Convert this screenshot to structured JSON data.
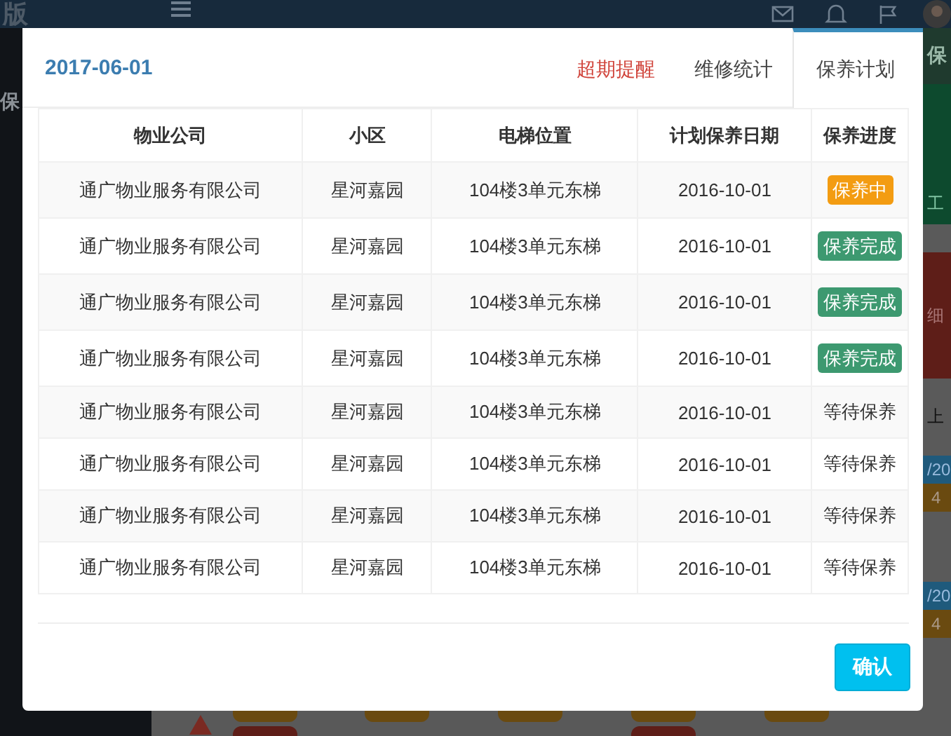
{
  "background": {
    "app_title": "版",
    "sidebar_text": "保",
    "right_strip": [
      {
        "kind": "dark",
        "text": "保"
      },
      {
        "kind": "green"
      },
      {
        "kind": "green",
        "text": "工"
      },
      {
        "kind": "gray"
      },
      {
        "kind": "red",
        "text": "细"
      },
      {
        "kind": "gray",
        "text": "上"
      },
      {
        "kind": "blue",
        "text": "/20"
      },
      {
        "kind": "brown",
        "text": "4"
      },
      {
        "kind": "gray"
      },
      {
        "kind": "blue",
        "text": "/20"
      },
      {
        "kind": "brown",
        "text": "4"
      }
    ]
  },
  "dialog": {
    "title": "2017-06-01",
    "tabs": [
      {
        "label": "超期提醒",
        "kind": "alert",
        "selected": false
      },
      {
        "label": "维修统计",
        "kind": "normal",
        "selected": false
      },
      {
        "label": "保养计划",
        "kind": "normal",
        "selected": true
      }
    ],
    "table": {
      "columns": [
        "物业公司",
        "小区",
        "电梯位置",
        "计划保养日期",
        "保养进度"
      ],
      "rows": [
        {
          "company": "通广物业服务有限公司",
          "community": "星河嘉园",
          "location": "104楼3单元东梯",
          "date": "2016-10-01",
          "status": {
            "kind": "in_progress",
            "text": "保养中"
          }
        },
        {
          "company": "通广物业服务有限公司",
          "community": "星河嘉园",
          "location": "104楼3单元东梯",
          "date": "2016-10-01",
          "status": {
            "kind": "done",
            "text": "保养完成"
          }
        },
        {
          "company": "通广物业服务有限公司",
          "community": "星河嘉园",
          "location": "104楼3单元东梯",
          "date": "2016-10-01",
          "status": {
            "kind": "done",
            "text": "保养完成"
          }
        },
        {
          "company": "通广物业服务有限公司",
          "community": "星河嘉园",
          "location": "104楼3单元东梯",
          "date": "2016-10-01",
          "status": {
            "kind": "done",
            "text": "保养完成"
          }
        },
        {
          "company": "通广物业服务有限公司",
          "community": "星河嘉园",
          "location": "104楼3单元东梯",
          "date": "2016-10-01",
          "status": {
            "kind": "waiting",
            "text": "等待保养"
          }
        },
        {
          "company": "通广物业服务有限公司",
          "community": "星河嘉园",
          "location": "104楼3单元东梯",
          "date": "2016-10-01",
          "status": {
            "kind": "waiting",
            "text": "等待保养"
          }
        },
        {
          "company": "通广物业服务有限公司",
          "community": "星河嘉园",
          "location": "104楼3单元东梯",
          "date": "2016-10-01",
          "status": {
            "kind": "waiting",
            "text": "等待保养"
          }
        },
        {
          "company": "通广物业服务有限公司",
          "community": "星河嘉园",
          "location": "104楼3单元东梯",
          "date": "2016-10-01",
          "status": {
            "kind": "waiting",
            "text": "等待保养"
          }
        }
      ]
    },
    "confirm_button": "确认"
  }
}
